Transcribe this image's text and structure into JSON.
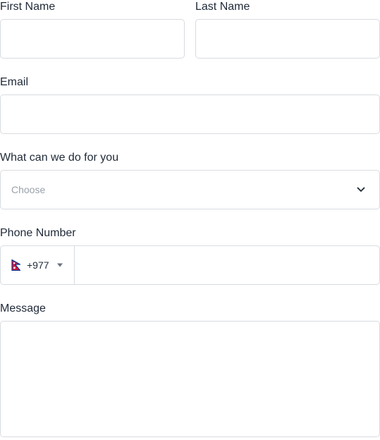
{
  "form": {
    "first_name": {
      "label": "First Name",
      "value": "",
      "placeholder": ""
    },
    "last_name": {
      "label": "Last Name",
      "value": "",
      "placeholder": ""
    },
    "email": {
      "label": "Email",
      "value": "",
      "placeholder": ""
    },
    "service": {
      "label": "What can we do for you",
      "placeholder": "Choose",
      "icon": "chevron-down-icon"
    },
    "phone": {
      "label": "Phone Number",
      "country_flag": "nepal-flag-icon",
      "dial_code": "+977",
      "caret_icon": "caret-down-icon",
      "value": "",
      "placeholder": ""
    },
    "message": {
      "label": "Message",
      "value": "",
      "placeholder": ""
    }
  },
  "colors": {
    "border": "#d8dbe0",
    "text": "#1f2937",
    "placeholder": "#9aa1ab",
    "flag_red": "#dc143c",
    "flag_blue": "#003893"
  }
}
